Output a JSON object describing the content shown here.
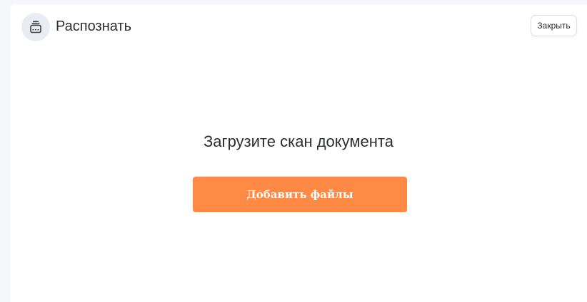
{
  "header": {
    "icon": "stacked-document-icon",
    "title": "Распознать",
    "close_label": "Закрыть"
  },
  "upload": {
    "heading": "Загрузите скан документа",
    "button_label": "Добавить файлы"
  },
  "colors": {
    "accent": "#ff8a45",
    "icon_bg": "#e9ecf2",
    "text": "#2b2d33",
    "page_bg": "#f6f7fb"
  }
}
